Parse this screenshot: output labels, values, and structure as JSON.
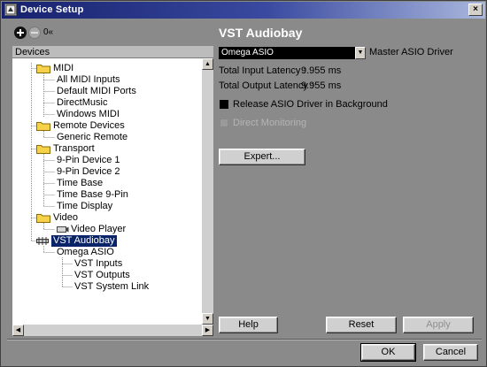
{
  "window": {
    "title": "Device Setup",
    "close_label": "×"
  },
  "toolbar": {
    "reset_label": "0«"
  },
  "devices": {
    "header": "Devices",
    "tree": [
      {
        "label": "MIDI",
        "kind": "folder"
      },
      {
        "label": "All MIDI Inputs",
        "kind": "item"
      },
      {
        "label": "Default MIDI Ports",
        "kind": "item"
      },
      {
        "label": "DirectMusic",
        "kind": "item"
      },
      {
        "label": "Windows MIDI",
        "kind": "item"
      },
      {
        "label": "Remote Devices",
        "kind": "folder"
      },
      {
        "label": "Generic Remote",
        "kind": "item"
      },
      {
        "label": "Transport",
        "kind": "folder"
      },
      {
        "label": "9-Pin Device 1",
        "kind": "item"
      },
      {
        "label": "9-Pin Device 2",
        "kind": "item"
      },
      {
        "label": "Time Base",
        "kind": "item"
      },
      {
        "label": "Time Base 9-Pin",
        "kind": "item"
      },
      {
        "label": "Time Display",
        "kind": "item"
      },
      {
        "label": "Video",
        "kind": "folder"
      },
      {
        "label": "Video Player",
        "kind": "item"
      },
      {
        "label": "VST Audiobay",
        "kind": "selected"
      },
      {
        "label": "Omega ASIO",
        "kind": "item"
      },
      {
        "label": "VST Inputs",
        "kind": "item"
      },
      {
        "label": "VST Outputs",
        "kind": "item"
      },
      {
        "label": "VST System Link",
        "kind": "item"
      }
    ]
  },
  "panel": {
    "title": "VST Audiobay",
    "driver_value": "Omega ASIO",
    "driver_label": "Master ASIO Driver",
    "input_latency_label": "Total Input Latency :",
    "input_latency_value": "9.955 ms",
    "output_latency_label": "Total Output Latency :",
    "output_latency_value": "9.955 ms",
    "release_label": "Release ASIO Driver in Background",
    "release_checked": true,
    "direct_monitoring_label": "Direct Monitoring",
    "direct_monitoring_checked": false,
    "expert_label": "Expert..."
  },
  "buttons": {
    "help": "Help",
    "reset": "Reset",
    "apply": "Apply",
    "ok": "OK",
    "cancel": "Cancel"
  },
  "colors": {
    "selection": "#0a246a",
    "dialog_bg": "#8a8a8a"
  }
}
